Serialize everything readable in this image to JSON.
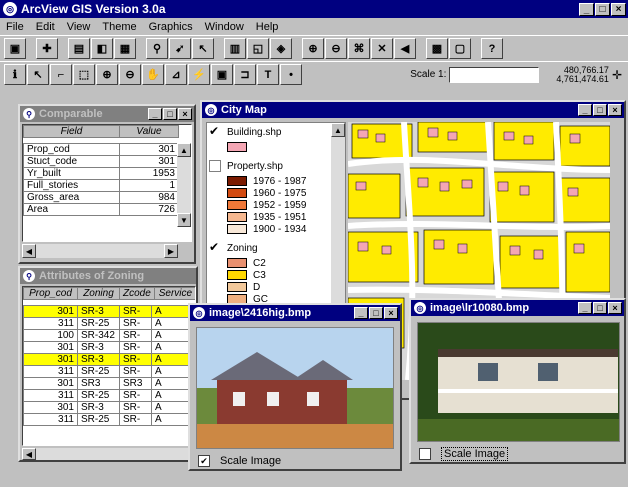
{
  "app": {
    "title": "ArcView GIS Version 3.0a"
  },
  "menu": [
    "File",
    "Edit",
    "View",
    "Theme",
    "Graphics",
    "Window",
    "Help"
  ],
  "toolbar": {
    "scale_label": "Scale 1:",
    "coord_x": "480,766.17",
    "coord_y": "4,761,474.61"
  },
  "comparable": {
    "title": "Comparable",
    "col_field": "Field",
    "col_value": "Value",
    "rows": [
      {
        "field": "Prop_cod",
        "value": "301"
      },
      {
        "field": "Stuct_code",
        "value": "301"
      },
      {
        "field": "Yr_built",
        "value": "1953"
      },
      {
        "field": "Full_stories",
        "value": "1"
      },
      {
        "field": "Gross_area",
        "value": "984"
      },
      {
        "field": "Area",
        "value": "726"
      }
    ]
  },
  "zoning": {
    "title": "Attributes of Zoning",
    "headers": [
      "Prop_cod",
      "Zoning",
      "Zcode",
      "Service"
    ],
    "rows": [
      {
        "c": [
          "301",
          "SR-3",
          "SR-",
          "A"
        ],
        "sel": true
      },
      {
        "c": [
          "311",
          "SR-25",
          "SR-",
          "A"
        ],
        "sel": false
      },
      {
        "c": [
          "100",
          "SR-342",
          "SR-",
          "A"
        ],
        "sel": false
      },
      {
        "c": [
          "301",
          "SR-3",
          "SR-",
          "A"
        ],
        "sel": false
      },
      {
        "c": [
          "301",
          "SR-3",
          "SR-",
          "A"
        ],
        "sel": true
      },
      {
        "c": [
          "311",
          "SR-25",
          "SR-",
          "A"
        ],
        "sel": false
      },
      {
        "c": [
          "301",
          "SR3",
          "SR3",
          "A"
        ],
        "sel": false
      },
      {
        "c": [
          "311",
          "SR-25",
          "SR-",
          "A"
        ],
        "sel": false
      },
      {
        "c": [
          "301",
          "SR-3",
          "SR-",
          "A"
        ],
        "sel": false
      },
      {
        "c": [
          "311",
          "SR-25",
          "SR-",
          "A"
        ],
        "sel": false
      }
    ]
  },
  "citymap": {
    "title": "City Map",
    "themes": [
      {
        "name": "Building.shp",
        "checked": true,
        "classes": [
          {
            "label": "",
            "color": "#f4a6b4"
          }
        ]
      },
      {
        "name": "Property.shp",
        "checked": false,
        "classes": [
          {
            "label": "1976 - 1987",
            "color": "#7a1a00"
          },
          {
            "label": "1960 - 1975",
            "color": "#d24a10"
          },
          {
            "label": "1952 - 1959",
            "color": "#f07838"
          },
          {
            "label": "1935 - 1951",
            "color": "#f6b890"
          },
          {
            "label": "1900 - 1934",
            "color": "#f8e8d8"
          }
        ]
      },
      {
        "name": "Zoning",
        "checked": true,
        "classes": [
          {
            "label": "C2",
            "color": "#e89070"
          },
          {
            "label": "C3",
            "color": "#ffd800"
          },
          {
            "label": "D",
            "color": "#f2c89a"
          },
          {
            "label": "GC",
            "color": "#f0b080"
          }
        ]
      }
    ]
  },
  "image1": {
    "title": "image\\2416hig.bmp",
    "checkbox_label": "Scale Image"
  },
  "image2": {
    "title": "image\\lr10080.bmp",
    "checkbox_label": "Scale Image"
  }
}
